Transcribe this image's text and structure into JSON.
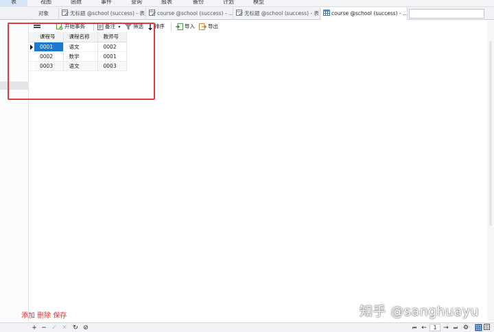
{
  "ribbon": {
    "tabs": [
      {
        "label": "表",
        "active": true
      },
      {
        "label": "视图"
      },
      {
        "label": "函数"
      },
      {
        "label": "事件"
      },
      {
        "label": "查询"
      },
      {
        "label": "报表"
      },
      {
        "label": "备份"
      },
      {
        "label": "计划"
      },
      {
        "label": "模型"
      }
    ]
  },
  "tabstrip": {
    "objects_label": "对象",
    "tabs": [
      {
        "label": "无标题 @school (success) - 表",
        "icon": "table-edit-icon"
      },
      {
        "label": "course @school (success) - ...",
        "icon": "table-edit-icon"
      },
      {
        "label": "无标题 @school (success) - 表",
        "icon": "table-edit-icon"
      },
      {
        "label": "course @school (success) - ...",
        "icon": "table-grid-icon",
        "active": true
      }
    ]
  },
  "toolbar": {
    "begin_transaction": "开始事务",
    "note": "备注",
    "filter": "筛选",
    "sort": "排序",
    "import": "导入",
    "export": "导出"
  },
  "grid": {
    "columns": [
      "课程号",
      "课程名称",
      "教师号"
    ],
    "rows": [
      [
        "0001",
        "语文",
        "0002"
      ],
      [
        "0002",
        "数学",
        "0001"
      ],
      [
        "0003",
        "语文",
        "0003"
      ]
    ],
    "selected_cell": "0001"
  },
  "annotation_text": "添加 删除 保存",
  "watermark": "知乎 @sanghuayu",
  "statusbar": {
    "page": "1"
  },
  "colors": {
    "annotation_red": "#e03a3a",
    "selection_blue": "#1b79d1"
  }
}
